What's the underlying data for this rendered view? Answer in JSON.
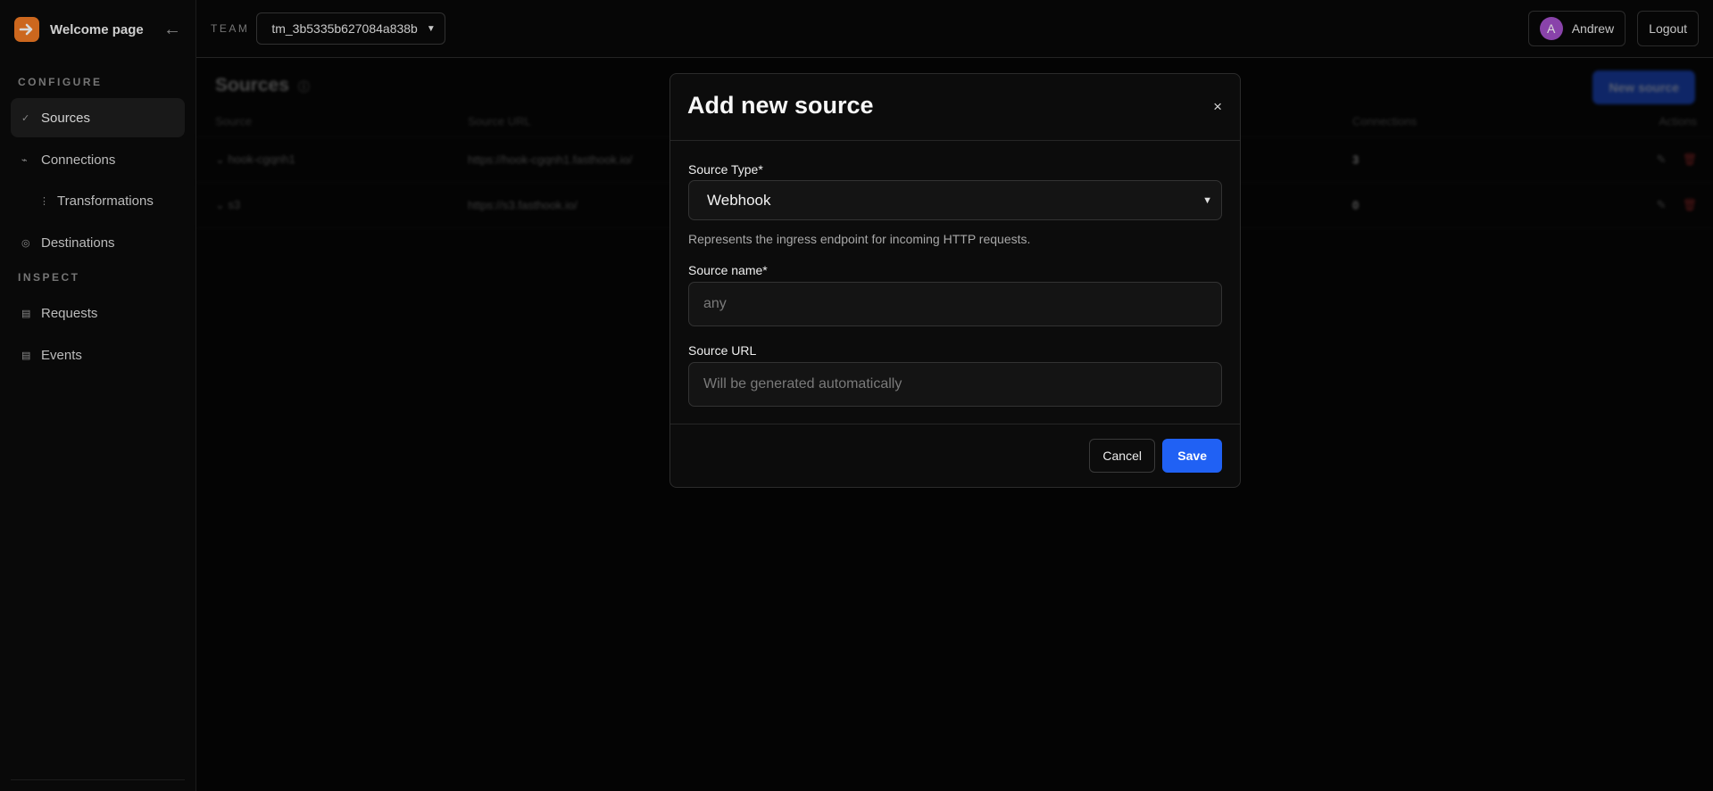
{
  "sidebar": {
    "brand_title": "Welcome page",
    "collapse_glyph": "←",
    "sections": {
      "configure": "CONFIGURE",
      "inspect": "INSPECT"
    },
    "items": [
      {
        "label": "Sources",
        "icon": "check-icon",
        "glyph": "✓"
      },
      {
        "label": "Connections",
        "icon": "connection-icon",
        "glyph": "⌁"
      },
      {
        "label": "Transformations",
        "icon": "transformation-icon",
        "glyph": "⋮"
      },
      {
        "label": "Destinations",
        "icon": "destination-icon",
        "glyph": "◎"
      },
      {
        "label": "Requests",
        "icon": "list-icon",
        "glyph": "▤"
      },
      {
        "label": "Events",
        "icon": "list-icon",
        "glyph": "▤"
      }
    ]
  },
  "topbar": {
    "team_label": "TEAM",
    "team_value": "tm_3b5335b627084a838b",
    "user_initial": "A",
    "user_name": "Andrew",
    "logout_label": "Logout"
  },
  "main": {
    "title": "Sources",
    "new_source_label": "New source",
    "table": {
      "headers": {
        "source": "Source",
        "url": "Source URL",
        "connections": "Connections",
        "actions": "Actions"
      },
      "rows": [
        {
          "source": "hook-cgqnh1",
          "url": "https://hook-cgqnh1.fasthook.io/",
          "connections": "3"
        },
        {
          "source": "s3",
          "url": "https://s3.fasthook.io/",
          "connections": "0"
        }
      ]
    }
  },
  "modal": {
    "title": "Add new source",
    "close_glyph": "×",
    "source_type_label": "Source Type*",
    "source_type_value": "Webhook",
    "source_type_help": "Represents the ingress endpoint for incoming HTTP requests.",
    "source_name_label": "Source name*",
    "source_name_placeholder": "any",
    "source_url_label": "Source URL",
    "source_url_placeholder": "Will be generated automatically",
    "cancel_label": "Cancel",
    "save_label": "Save"
  },
  "colors": {
    "accent": "#2061f4",
    "brand": "#f07a24",
    "avatar": "#a24fc8"
  }
}
